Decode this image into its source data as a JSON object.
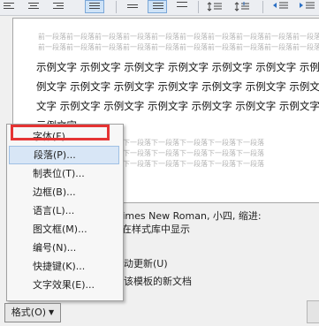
{
  "toolbar": {
    "buttons": [
      "align-left-icon",
      "align-center-icon",
      "align-right-icon",
      "align-justify-active-icon",
      "single-spacing-icon",
      "one-half-spacing-icon",
      "double-spacing-icon",
      "spacing-before-icon",
      "spacing-after-icon",
      "decrease-indent-icon",
      "increase-indent-icon"
    ]
  },
  "preview": {
    "prev_paragraph_lines": [
      "前一段落前一段落前一段落前一段落前一段落前一段落前一段落前一段落前一段落前一段落",
      "前一段落前一段落前一段落前一段落前一段落前一段落前一段落前一段落前一段落前一段落"
    ],
    "sample_lines": [
      "示例文字 示例文字 示例文字 示例文字 示例文字 示例文字 示例文字",
      "例文字 示例文字 示例文字 示例文字 示例文字 示例文字 示例文字 示",
      "文字 示例文字 示例文字 示例文字 示例文字 示例文字 示例文字 示例",
      "示例文字"
    ],
    "next_paragraph_lines": [
      "下一段落下一段落下一段落下一段落下一段落下一段落下一段落下一段落",
      "下一段落下一段落下一段落下一段落下一段落下一段落下一段落下一段落",
      "下一段落下一段落下一段落下一段落下一段落下一段落下一段落下一段落"
    ]
  },
  "description": {
    "font_line": "Times New Roman, 小四, 缩进:",
    "style_line": "在样式库中显示",
    "auto_update": "动更新(U)",
    "template_option": "该模板的新文档"
  },
  "menu": {
    "items": [
      {
        "label": "字体(F)...",
        "name": "menu-item-font"
      },
      {
        "label": "段落(P)...",
        "name": "menu-item-paragraph"
      },
      {
        "label": "制表位(T)...",
        "name": "menu-item-tabs"
      },
      {
        "label": "边框(B)...",
        "name": "menu-item-border"
      },
      {
        "label": "语言(L)...",
        "name": "menu-item-language"
      },
      {
        "label": "图文框(M)...",
        "name": "menu-item-frame"
      },
      {
        "label": "编号(N)...",
        "name": "menu-item-numbering"
      },
      {
        "label": "快捷键(K)...",
        "name": "menu-item-shortcut-key"
      },
      {
        "label": "文字效果(E)...",
        "name": "menu-item-text-effects"
      }
    ],
    "hovered_item": "段落(P)...",
    "highlighted_item": "字体(F)...",
    "highlight_color": "#e53333"
  },
  "format_button": {
    "label": "格式(O)",
    "caret": "▼"
  }
}
